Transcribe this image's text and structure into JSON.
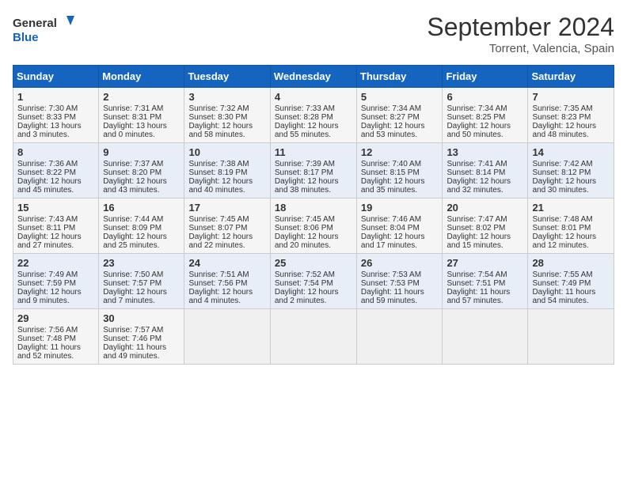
{
  "header": {
    "logo_line1": "General",
    "logo_line2": "Blue",
    "month": "September 2024",
    "location": "Torrent, Valencia, Spain"
  },
  "days_of_week": [
    "Sunday",
    "Monday",
    "Tuesday",
    "Wednesday",
    "Thursday",
    "Friday",
    "Saturday"
  ],
  "weeks": [
    [
      {
        "day": "1",
        "lines": [
          "Sunrise: 7:30 AM",
          "Sunset: 8:33 PM",
          "Daylight: 13 hours",
          "and 3 minutes."
        ]
      },
      {
        "day": "2",
        "lines": [
          "Sunrise: 7:31 AM",
          "Sunset: 8:31 PM",
          "Daylight: 13 hours",
          "and 0 minutes."
        ]
      },
      {
        "day": "3",
        "lines": [
          "Sunrise: 7:32 AM",
          "Sunset: 8:30 PM",
          "Daylight: 12 hours",
          "and 58 minutes."
        ]
      },
      {
        "day": "4",
        "lines": [
          "Sunrise: 7:33 AM",
          "Sunset: 8:28 PM",
          "Daylight: 12 hours",
          "and 55 minutes."
        ]
      },
      {
        "day": "5",
        "lines": [
          "Sunrise: 7:34 AM",
          "Sunset: 8:27 PM",
          "Daylight: 12 hours",
          "and 53 minutes."
        ]
      },
      {
        "day": "6",
        "lines": [
          "Sunrise: 7:34 AM",
          "Sunset: 8:25 PM",
          "Daylight: 12 hours",
          "and 50 minutes."
        ]
      },
      {
        "day": "7",
        "lines": [
          "Sunrise: 7:35 AM",
          "Sunset: 8:23 PM",
          "Daylight: 12 hours",
          "and 48 minutes."
        ]
      }
    ],
    [
      {
        "day": "8",
        "lines": [
          "Sunrise: 7:36 AM",
          "Sunset: 8:22 PM",
          "Daylight: 12 hours",
          "and 45 minutes."
        ]
      },
      {
        "day": "9",
        "lines": [
          "Sunrise: 7:37 AM",
          "Sunset: 8:20 PM",
          "Daylight: 12 hours",
          "and 43 minutes."
        ]
      },
      {
        "day": "10",
        "lines": [
          "Sunrise: 7:38 AM",
          "Sunset: 8:19 PM",
          "Daylight: 12 hours",
          "and 40 minutes."
        ]
      },
      {
        "day": "11",
        "lines": [
          "Sunrise: 7:39 AM",
          "Sunset: 8:17 PM",
          "Daylight: 12 hours",
          "and 38 minutes."
        ]
      },
      {
        "day": "12",
        "lines": [
          "Sunrise: 7:40 AM",
          "Sunset: 8:15 PM",
          "Daylight: 12 hours",
          "and 35 minutes."
        ]
      },
      {
        "day": "13",
        "lines": [
          "Sunrise: 7:41 AM",
          "Sunset: 8:14 PM",
          "Daylight: 12 hours",
          "and 32 minutes."
        ]
      },
      {
        "day": "14",
        "lines": [
          "Sunrise: 7:42 AM",
          "Sunset: 8:12 PM",
          "Daylight: 12 hours",
          "and 30 minutes."
        ]
      }
    ],
    [
      {
        "day": "15",
        "lines": [
          "Sunrise: 7:43 AM",
          "Sunset: 8:11 PM",
          "Daylight: 12 hours",
          "and 27 minutes."
        ]
      },
      {
        "day": "16",
        "lines": [
          "Sunrise: 7:44 AM",
          "Sunset: 8:09 PM",
          "Daylight: 12 hours",
          "and 25 minutes."
        ]
      },
      {
        "day": "17",
        "lines": [
          "Sunrise: 7:45 AM",
          "Sunset: 8:07 PM",
          "Daylight: 12 hours",
          "and 22 minutes."
        ]
      },
      {
        "day": "18",
        "lines": [
          "Sunrise: 7:45 AM",
          "Sunset: 8:06 PM",
          "Daylight: 12 hours",
          "and 20 minutes."
        ]
      },
      {
        "day": "19",
        "lines": [
          "Sunrise: 7:46 AM",
          "Sunset: 8:04 PM",
          "Daylight: 12 hours",
          "and 17 minutes."
        ]
      },
      {
        "day": "20",
        "lines": [
          "Sunrise: 7:47 AM",
          "Sunset: 8:02 PM",
          "Daylight: 12 hours",
          "and 15 minutes."
        ]
      },
      {
        "day": "21",
        "lines": [
          "Sunrise: 7:48 AM",
          "Sunset: 8:01 PM",
          "Daylight: 12 hours",
          "and 12 minutes."
        ]
      }
    ],
    [
      {
        "day": "22",
        "lines": [
          "Sunrise: 7:49 AM",
          "Sunset: 7:59 PM",
          "Daylight: 12 hours",
          "and 9 minutes."
        ]
      },
      {
        "day": "23",
        "lines": [
          "Sunrise: 7:50 AM",
          "Sunset: 7:57 PM",
          "Daylight: 12 hours",
          "and 7 minutes."
        ]
      },
      {
        "day": "24",
        "lines": [
          "Sunrise: 7:51 AM",
          "Sunset: 7:56 PM",
          "Daylight: 12 hours",
          "and 4 minutes."
        ]
      },
      {
        "day": "25",
        "lines": [
          "Sunrise: 7:52 AM",
          "Sunset: 7:54 PM",
          "Daylight: 12 hours",
          "and 2 minutes."
        ]
      },
      {
        "day": "26",
        "lines": [
          "Sunrise: 7:53 AM",
          "Sunset: 7:53 PM",
          "Daylight: 11 hours",
          "and 59 minutes."
        ]
      },
      {
        "day": "27",
        "lines": [
          "Sunrise: 7:54 AM",
          "Sunset: 7:51 PM",
          "Daylight: 11 hours",
          "and 57 minutes."
        ]
      },
      {
        "day": "28",
        "lines": [
          "Sunrise: 7:55 AM",
          "Sunset: 7:49 PM",
          "Daylight: 11 hours",
          "and 54 minutes."
        ]
      }
    ],
    [
      {
        "day": "29",
        "lines": [
          "Sunrise: 7:56 AM",
          "Sunset: 7:48 PM",
          "Daylight: 11 hours",
          "and 52 minutes."
        ]
      },
      {
        "day": "30",
        "lines": [
          "Sunrise: 7:57 AM",
          "Sunset: 7:46 PM",
          "Daylight: 11 hours",
          "and 49 minutes."
        ]
      },
      {
        "day": "",
        "lines": []
      },
      {
        "day": "",
        "lines": []
      },
      {
        "day": "",
        "lines": []
      },
      {
        "day": "",
        "lines": []
      },
      {
        "day": "",
        "lines": []
      }
    ]
  ]
}
